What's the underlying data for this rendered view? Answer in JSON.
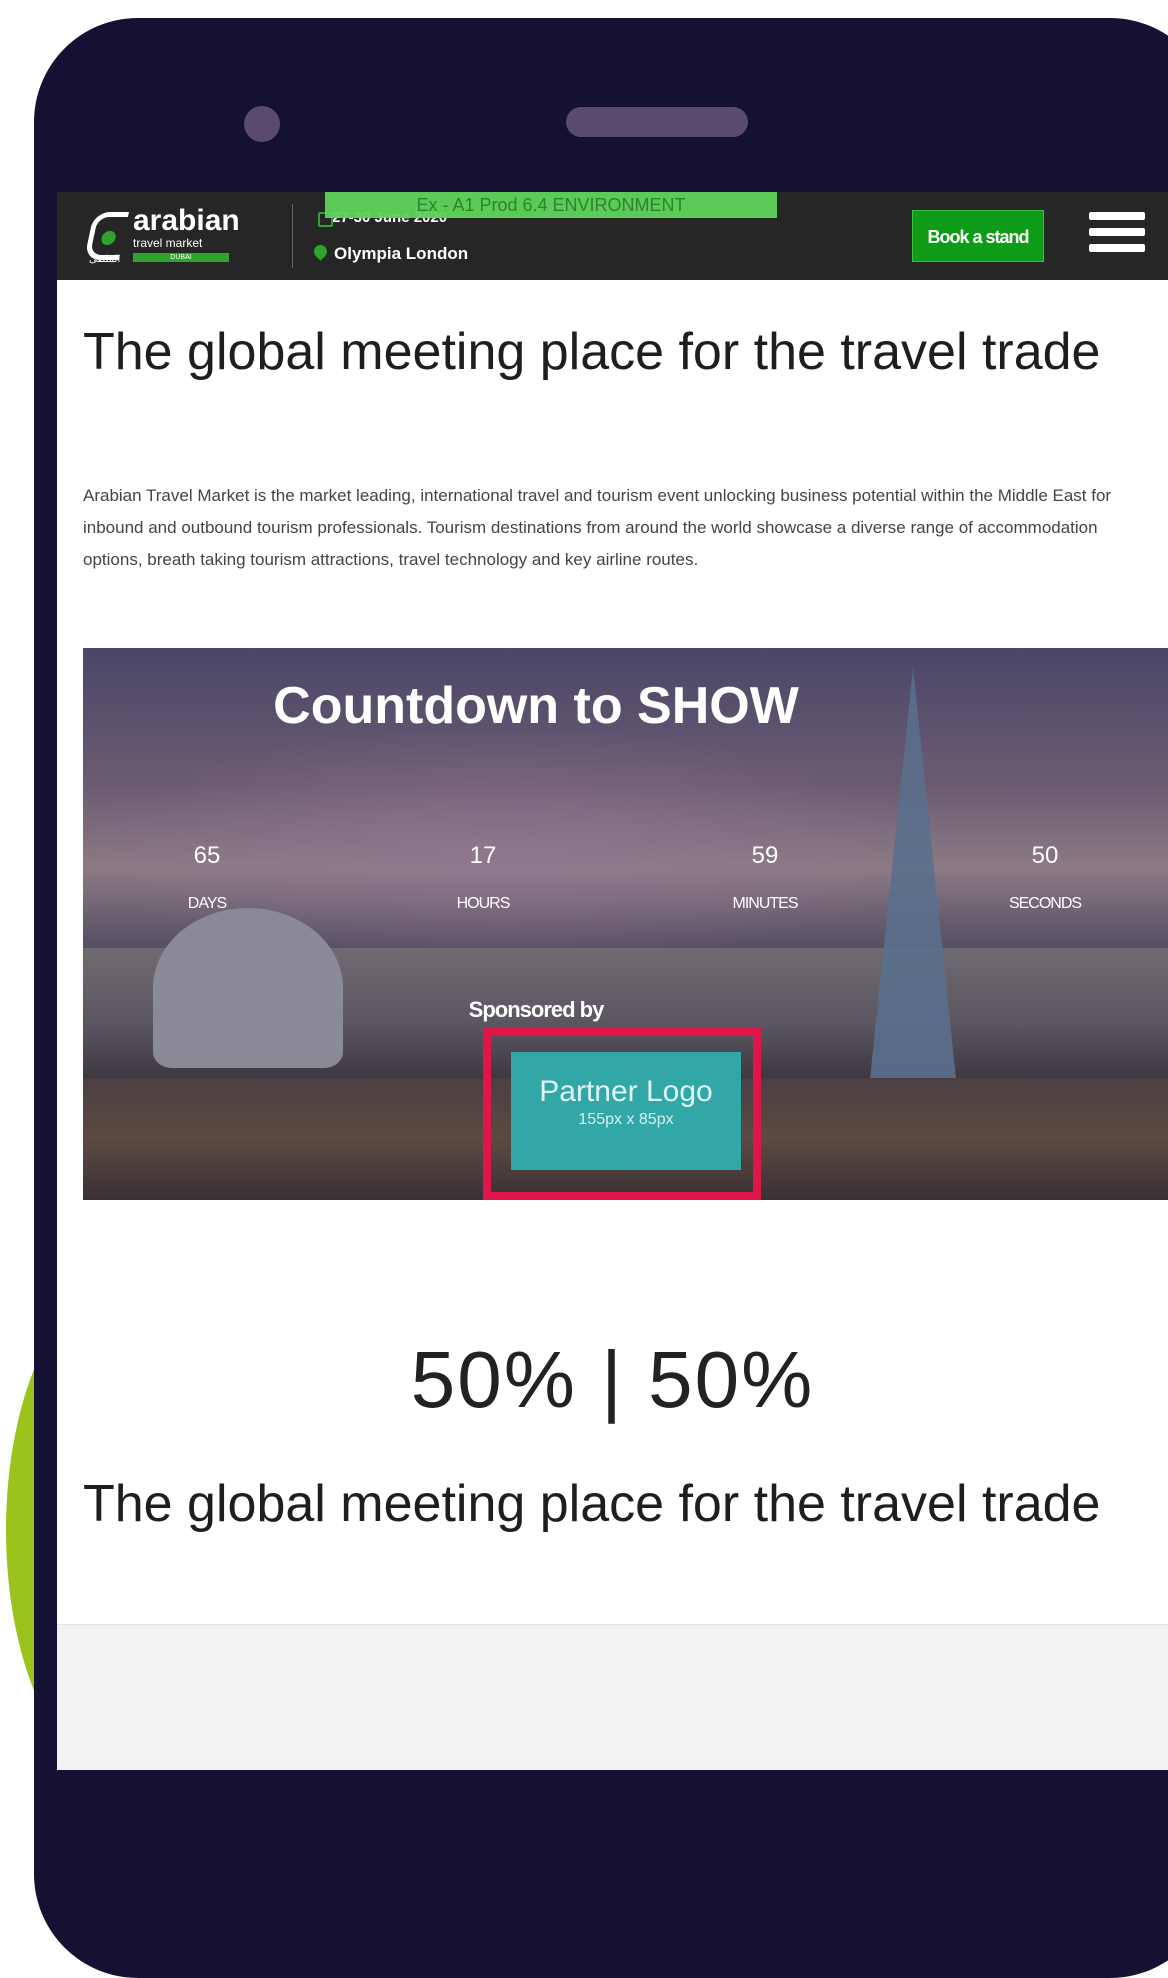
{
  "header": {
    "logo_text": "arabian",
    "logo_subtext": "travel market",
    "logo_arabic": "الملتقى",
    "logo_bar_text": "DUBAI",
    "environment_banner": "Ex - A1 Prod 6.4 ENVIRONMENT",
    "event_date": "27-30 June 2020",
    "location": "Olympia London",
    "book_button": "Book a stand"
  },
  "intro": {
    "title": "The global meeting place for the travel trade",
    "body": "Arabian Travel Market is the market leading, international travel and tourism event unlocking business potential within the Middle East for inbound and outbound tourism professionals. Tourism destinations from around the world showcase a diverse range of accommodation options, breath taking tourism attractions, travel technology and key airline routes."
  },
  "countdown": {
    "title": "Countdown to SHOW",
    "days": {
      "value": "65",
      "label": "DAYS"
    },
    "hours": {
      "value": "17",
      "label": "HOURS"
    },
    "minutes": {
      "value": "59",
      "label": "MINUTES"
    },
    "seconds": {
      "value": "50",
      "label": "SECONDS"
    },
    "sponsored_label": "Sponsored by",
    "partner_logo_text": "Partner Logo",
    "partner_logo_size": "155px x 85px"
  },
  "split": {
    "percent_text": "50% | 50%",
    "title": "The global meeting place for the travel trade"
  },
  "colors": {
    "phone_frame": "#151133",
    "accent_green": "#0e9b18",
    "highlight_red": "#e0154a",
    "partner_teal": "#31a7a8"
  }
}
